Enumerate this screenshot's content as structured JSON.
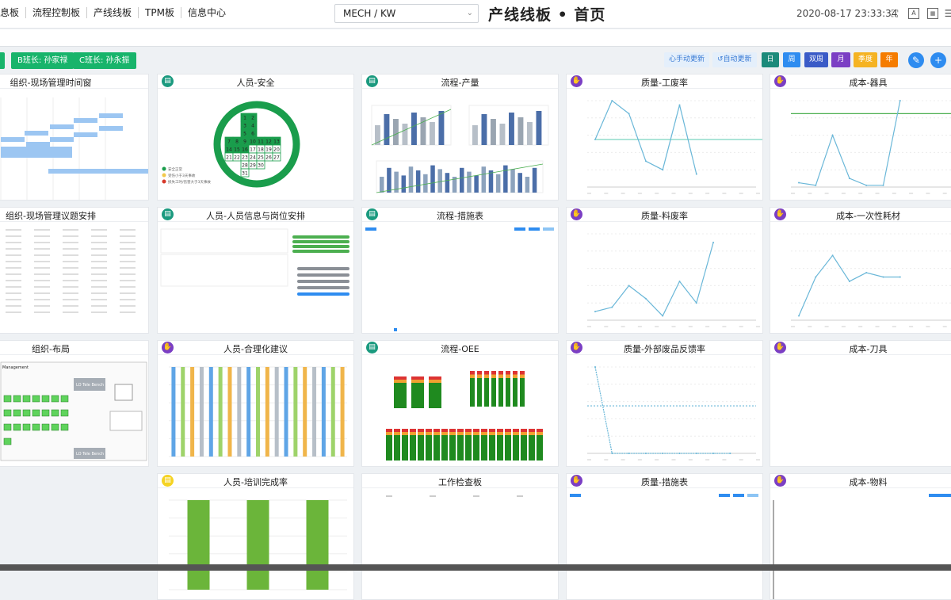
{
  "nav": {
    "items": [
      "息板",
      "流程控制板",
      "产线线板",
      "TPM板",
      "信息中心"
    ]
  },
  "header": {
    "select_value": "MECH / KW",
    "page_title": "产线线板 • 首页",
    "datetime": "2020-08-17 23:33:34"
  },
  "toolbar": {
    "shift_btn_b": "B班长: 孙家禄",
    "shift_btn_c": "C班长: 孙永振",
    "manual_refresh": "心手动更新",
    "auto_refresh": "↺自动更新",
    "periods": [
      "日",
      "周",
      "双周",
      "月",
      "季度",
      "年"
    ],
    "period_colors": [
      "#1b8a7a",
      "#2e8cf0",
      "#3a5bc7",
      "#7b3fc4",
      "#f5b323",
      "#f57c00"
    ]
  },
  "cards": [
    {
      "title": "组织-现场管理时间窗"
    },
    {
      "title": "人员-安全",
      "legend": [
        "安全正常",
        "受伤小于3天事故",
        "损失工时/伤害大于3天事故"
      ],
      "calendar": [
        "1",
        "2",
        "3",
        "4",
        "5",
        "6",
        "7",
        "8",
        "9",
        "10",
        "11",
        "12",
        "13",
        "14",
        "15",
        "16",
        "17",
        "18",
        "19",
        "20",
        "21",
        "22",
        "23",
        "24",
        "25",
        "26",
        "27",
        "28",
        "29",
        "30",
        "31"
      ]
    },
    {
      "title": "流程-产量"
    },
    {
      "title": "质量-工废率"
    },
    {
      "title": "成本-器具"
    },
    {
      "title": "组织-现场管理议题安排"
    },
    {
      "title": "人员-人员信息与岗位安排"
    },
    {
      "title": "流程-措施表"
    },
    {
      "title": "质量-料废率"
    },
    {
      "title": "成本-一次性耗材"
    },
    {
      "title": "组织-布局",
      "layout_labels": [
        "Management",
        "LO Tele Bench",
        "LO Tele Bench"
      ]
    },
    {
      "title": "人员-合理化建议"
    },
    {
      "title": "流程-OEE"
    },
    {
      "title": "质量-外部废品反馈率"
    },
    {
      "title": "成本-刀具"
    },
    {
      "title": "人员-培训完成率"
    },
    {
      "title": "工作检查板"
    },
    {
      "title": "质量-措施表"
    },
    {
      "title": "成本-物料"
    }
  ],
  "chart_data": [
    {
      "type": "line",
      "title": "质量-工废率",
      "values": [
        0.55,
        1.0,
        0.85,
        0.3,
        0.2,
        0.95,
        0.15
      ],
      "target": [
        0.55,
        0.55,
        0.55,
        0.55,
        0.55,
        0.55,
        0.55,
        0.55,
        0.55,
        0.55,
        0.55
      ]
    },
    {
      "type": "line",
      "title": "成本-器具",
      "values": [
        0.05,
        0.02,
        0.6,
        0.1,
        0.02,
        0.02,
        1.0
      ],
      "target": 0.85
    },
    {
      "type": "line",
      "title": "质量-料废率",
      "values": [
        0.1,
        0.15,
        0.4,
        0.25,
        0.05,
        0.45,
        0.2,
        0.9
      ]
    },
    {
      "type": "line",
      "title": "成本-一次性耗材",
      "values": [
        0.05,
        0.5,
        0.75,
        0.45,
        0.55,
        0.5,
        0.5
      ]
    },
    {
      "type": "line",
      "title": "质量-外部废品反馈率",
      "values": [
        1.0,
        0.0,
        0.0,
        0.0,
        0.0,
        0.0,
        0.0,
        0.0,
        0.0
      ],
      "target": 0.55
    },
    {
      "type": "bar",
      "title": "人员-合理化建议",
      "values": [
        1,
        1,
        1,
        1,
        1,
        1,
        1,
        1,
        1,
        1,
        1,
        1,
        1,
        1,
        1,
        1,
        1,
        1,
        1
      ]
    },
    {
      "type": "bar",
      "title": "人员-培训完成率",
      "values": [
        1,
        1,
        1
      ]
    }
  ]
}
